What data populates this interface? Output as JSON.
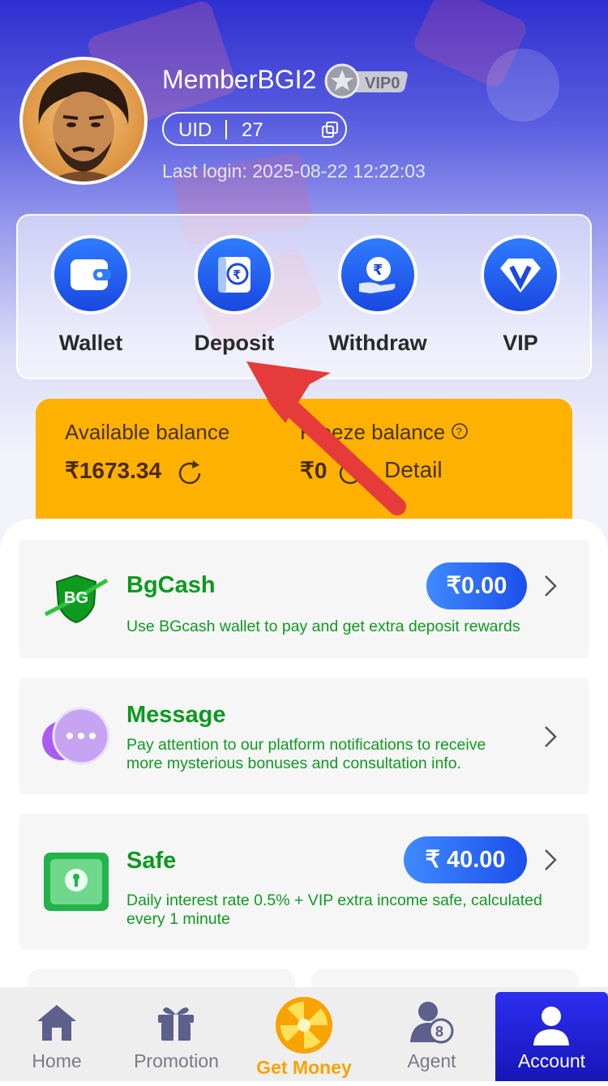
{
  "profile": {
    "username": "MemberBGI2",
    "vip_badge": "VIP0",
    "uid_label": "UID",
    "uid_value": "27",
    "last_login": "Last login: 2025-08-22 12:22:03"
  },
  "quick_actions": [
    {
      "label": "Wallet",
      "icon": "wallet-icon"
    },
    {
      "label": "Deposit",
      "icon": "rupee-deposit-icon"
    },
    {
      "label": "Withdraw",
      "icon": "rupee-hand-icon"
    },
    {
      "label": "VIP",
      "icon": "vip-diamond-icon"
    }
  ],
  "balance": {
    "available_label": "Available balance",
    "available_value": "₹1673.34",
    "freeze_label": "Freeze balance",
    "freeze_value": "₹0",
    "detail_label": "Detail"
  },
  "cards": {
    "bgcash": {
      "title": "BgCash",
      "amount": "₹0.00",
      "desc": "Use BGcash wallet to pay and get extra deposit rewards"
    },
    "message": {
      "title": "Message",
      "desc1": "Pay attention to our platform notifications to receive",
      "desc2": "more mysterious bonuses and consultation info."
    },
    "safe": {
      "title": "Safe",
      "amount": "₹ 40.00",
      "desc1": "Daily interest rate 0.5% + VIP extra income safe, calculated",
      "desc2": "every 1 minute"
    }
  },
  "tabs": [
    {
      "label": "Home",
      "icon": "home-icon"
    },
    {
      "label": "Promotion",
      "icon": "gift-icon"
    },
    {
      "label": "Get Money",
      "icon": "wheel-icon"
    },
    {
      "label": "Agent",
      "icon": "agent-icon"
    },
    {
      "label": "Account",
      "icon": "account-icon"
    }
  ],
  "colors": {
    "accent_blue": "#1a48e0",
    "balance_orange": "#ffb102",
    "green_text": "#0a9a1e",
    "arrow_red": "#e63b3b"
  }
}
